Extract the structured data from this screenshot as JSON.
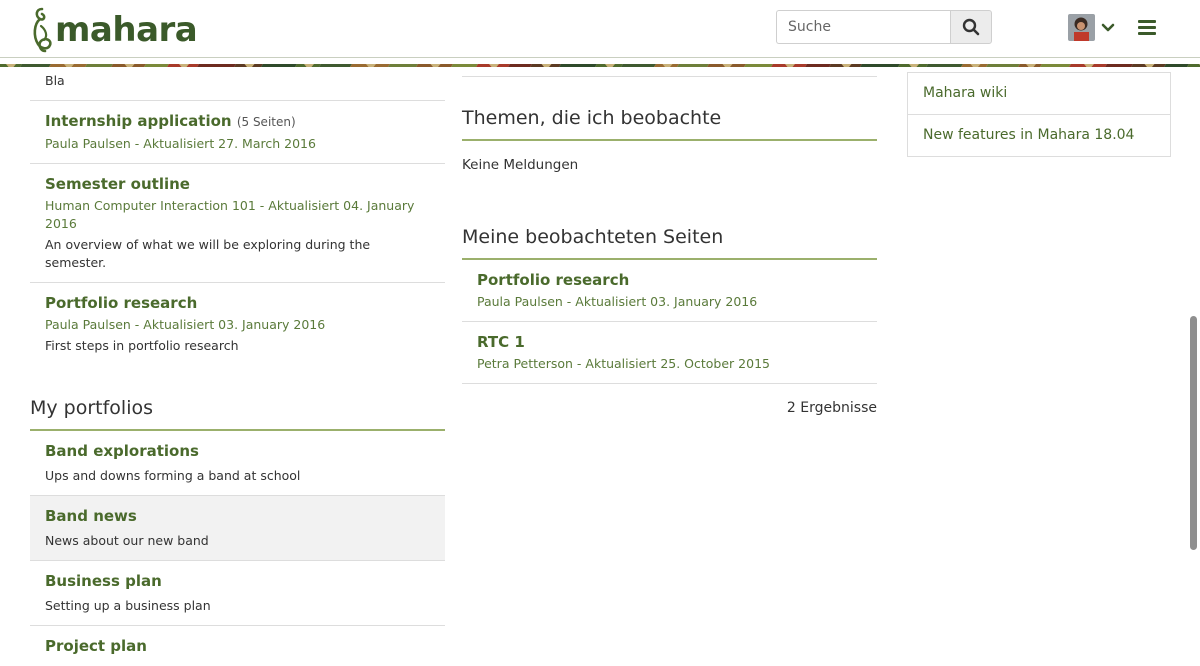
{
  "header": {
    "logo_text": "mahara",
    "search_placeholder": "Suche",
    "icons": {
      "search": "search-icon",
      "user_menu": "chevron-down-icon",
      "menu": "hamburger-icon"
    }
  },
  "colors": {
    "brand_green": "#4a6a2c",
    "heading_rule": "#9bb06c"
  },
  "left": {
    "top_desc": "Bla",
    "items": [
      {
        "title": "Internship application",
        "count": "(5 Seiten)",
        "meta": "Paula Paulsen - Aktualisiert 27. March 2016",
        "desc": ""
      },
      {
        "title": "Semester outline",
        "count": "",
        "meta": "Human Computer Interaction 101 - Aktualisiert 04. January 2016",
        "desc": "An overview of what we will be exploring during the semester."
      },
      {
        "title": "Portfolio research",
        "count": "",
        "meta": "Paula Paulsen - Aktualisiert 03. January 2016",
        "desc": "First steps in portfolio research"
      }
    ],
    "portfolios": {
      "heading": "My portfolios",
      "items": [
        {
          "title": "Band explorations",
          "desc": "Ups and downs forming a band at school"
        },
        {
          "title": "Band news",
          "desc": "News about our new band"
        },
        {
          "title": "Business plan",
          "desc": "Setting up a business plan"
        },
        {
          "title": "Project plan",
          "desc": ""
        }
      ]
    }
  },
  "middle": {
    "topics": {
      "heading": "Themen, die ich beobachte",
      "empty": "Keine Meldungen"
    },
    "watched": {
      "heading": "Meine beobachteten Seiten",
      "items": [
        {
          "title": "Portfolio research",
          "meta": "Paula Paulsen - Aktualisiert 03. January 2016"
        },
        {
          "title": "RTC 1",
          "meta": "Petra Petterson - Aktualisiert 25. October 2015"
        }
      ],
      "results": "2 Ergebnisse"
    }
  },
  "right": {
    "links": [
      "Mahara wiki",
      "New features in Mahara 18.04"
    ]
  }
}
